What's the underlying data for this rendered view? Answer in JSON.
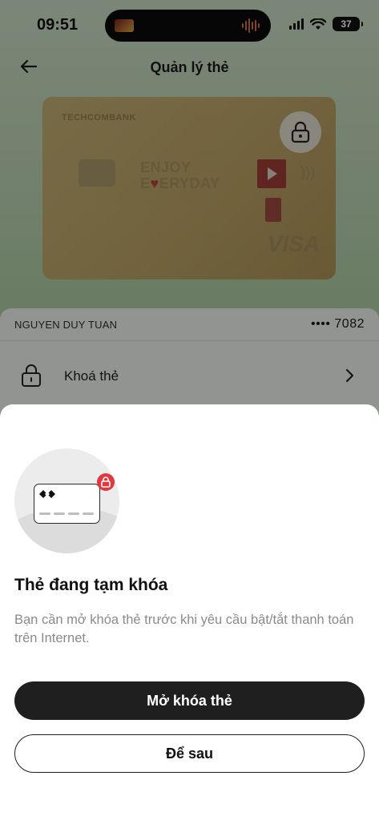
{
  "status_bar": {
    "time": "09:51",
    "battery": "37"
  },
  "header": {
    "title": "Quản lý thẻ"
  },
  "card": {
    "bank_name": "TECHCOMBANK",
    "slogan_line1": "ENJOY",
    "slogan_line2_start": "E",
    "slogan_line2_end": "ERYDAY",
    "network": "VISA"
  },
  "card_info": {
    "holder_name": "NGUYEN DUY TUAN",
    "masked_number": "•••• 7082"
  },
  "menu": {
    "lock_card_label": "Khoá thẻ"
  },
  "sheet": {
    "title": "Thẻ đang tạm khóa",
    "description": "Bạn cần mở khóa thẻ trước khi yêu cầu bật/tắt thanh toán trên Internet.",
    "primary_button": "Mở khóa thẻ",
    "secondary_button": "Để sau"
  },
  "colors": {
    "accent_red": "#e0383e",
    "button_dark": "#1f1f1f"
  }
}
